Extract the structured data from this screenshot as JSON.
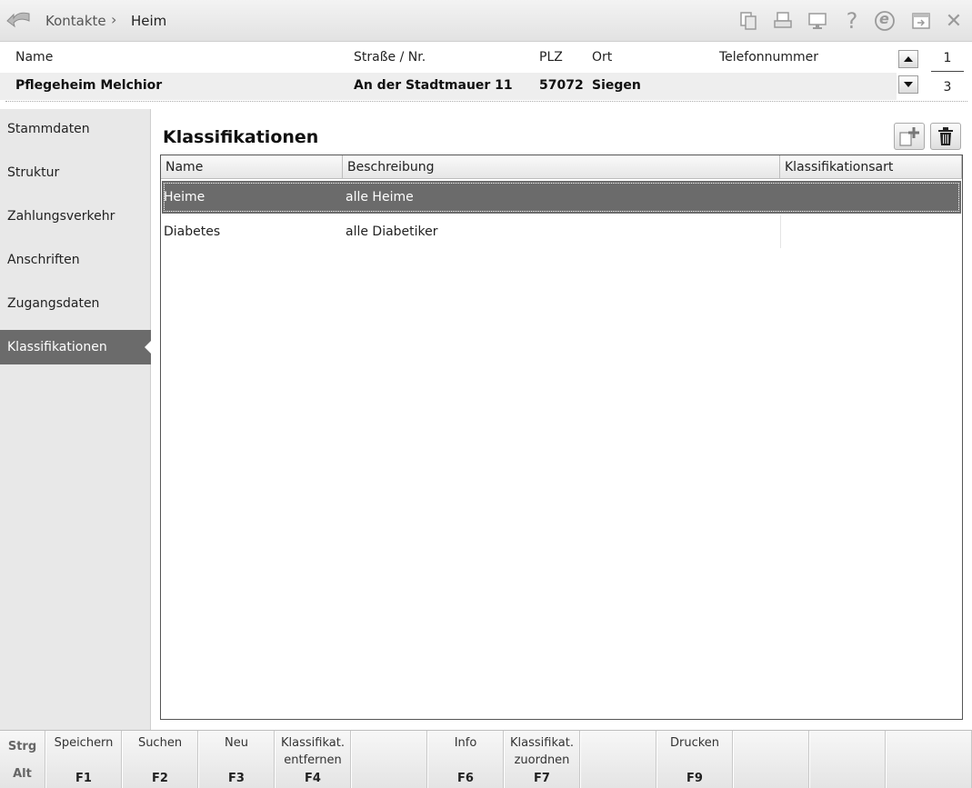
{
  "titlebar": {
    "breadcrumb": [
      "Kontakte",
      "Heim"
    ],
    "separator": "›",
    "icons": [
      "copy-icon",
      "print-icon",
      "monitor-icon",
      "help-icon",
      "e-icon",
      "window-switch-icon",
      "close-icon"
    ],
    "help_glyph": "?",
    "e_glyph": "e",
    "close_glyph": "✕"
  },
  "header": {
    "columns": {
      "name": "Name",
      "street": "Straße / Nr.",
      "zip": "PLZ",
      "city": "Ort",
      "phone": "Telefonnummer"
    },
    "record": {
      "name": "Pflegeheim Melchior",
      "street": "An der Stadtmauer 11",
      "zip": "57072",
      "city": "Siegen",
      "phone": ""
    },
    "page_current": "1",
    "page_total": "3"
  },
  "sidebar": {
    "items": [
      {
        "label": "Stammdaten"
      },
      {
        "label": "Struktur"
      },
      {
        "label": "Zahlungsverkehr"
      },
      {
        "label": "Anschriften"
      },
      {
        "label": "Zugangsdaten"
      },
      {
        "label": "Klassifikationen"
      }
    ],
    "active_index": 5
  },
  "main": {
    "title": "Klassifikationen",
    "columns": [
      "Name",
      "Beschreibung",
      "Klassifikationsart"
    ],
    "rows": [
      {
        "name": "Heime",
        "description": "alle Heime",
        "type": "",
        "selected": true
      },
      {
        "name": "Diabetes",
        "description": "alle Diabetiker",
        "type": "",
        "selected": false
      }
    ]
  },
  "footer": {
    "modifiers": [
      "Strg",
      "Alt"
    ],
    "keys": [
      {
        "label": "Speichern",
        "key": "F1"
      },
      {
        "label": "Suchen",
        "key": "F2"
      },
      {
        "label": "Neu",
        "key": "F3"
      },
      {
        "label": "Klassifikat.\nentfernen",
        "key": "F4"
      },
      {
        "label": "",
        "key": ""
      },
      {
        "label": "Info",
        "key": "F6"
      },
      {
        "label": "Klassifikat.\nzuordnen",
        "key": "F7"
      },
      {
        "label": "",
        "key": ""
      },
      {
        "label": "Drucken",
        "key": "F9"
      },
      {
        "label": "",
        "key": ""
      },
      {
        "label": "",
        "key": ""
      },
      {
        "label": "",
        "key": ""
      }
    ]
  },
  "colors": {
    "selection": "#6b6b6b",
    "accent": "#cc2222"
  }
}
